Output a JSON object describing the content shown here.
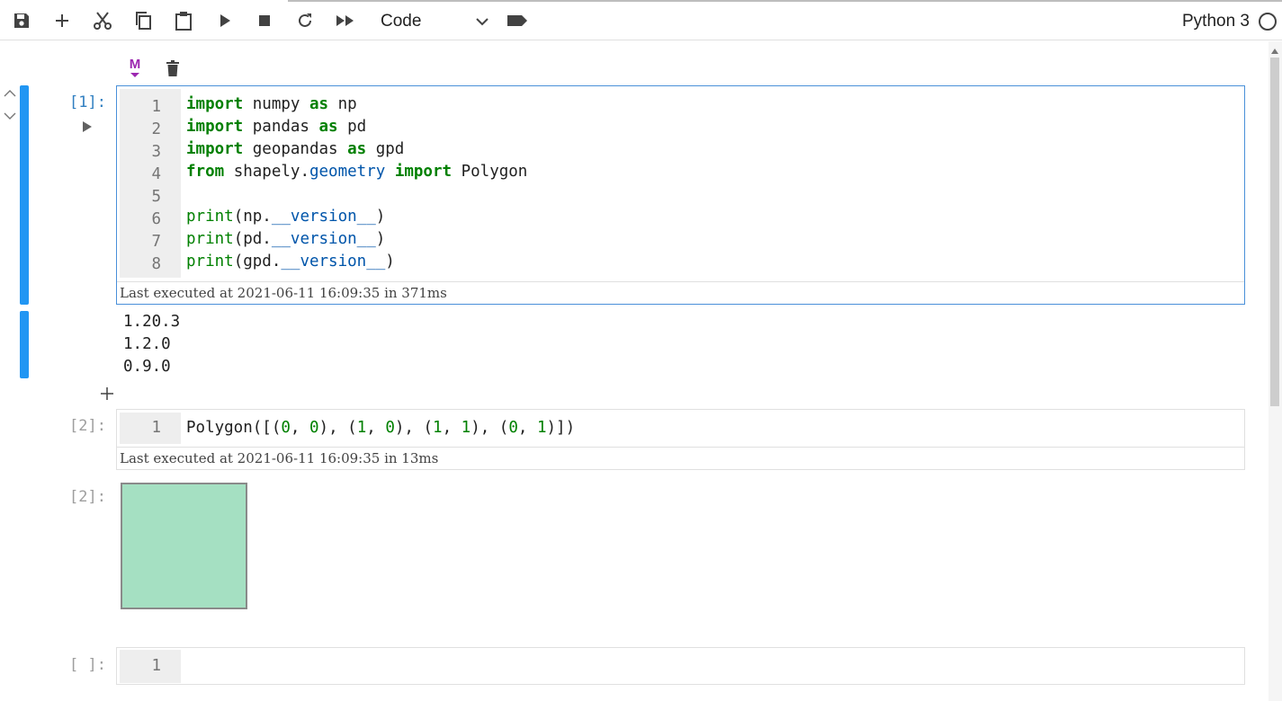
{
  "toolbar": {
    "buttons": [
      {
        "name": "save-icon",
        "label": "save"
      },
      {
        "name": "add-icon",
        "label": "insert cell"
      },
      {
        "name": "cut-icon",
        "label": "cut"
      },
      {
        "name": "copy-icon",
        "label": "copy"
      },
      {
        "name": "paste-icon",
        "label": "paste"
      },
      {
        "name": "run-icon",
        "label": "run"
      },
      {
        "name": "stop-icon",
        "label": "interrupt"
      },
      {
        "name": "restart-icon",
        "label": "restart"
      },
      {
        "name": "fast-forward-icon",
        "label": "restart and run all"
      }
    ],
    "cell_type": "Code",
    "kernel_name": "Python 3"
  },
  "colors": {
    "accent": "#2196f3",
    "keyword": "#008000",
    "attribute": "#0055aa",
    "markdown_icon": "#9c27b0",
    "polygon_fill": "#a5e0c2"
  },
  "cell_toolbar": {
    "markdown_label": "M"
  },
  "cells": [
    {
      "prompt": "[1]:",
      "lines": [
        {
          "n": "1"
        },
        {
          "n": "2"
        },
        {
          "n": "3"
        },
        {
          "n": "4"
        },
        {
          "n": "5"
        },
        {
          "n": "6"
        },
        {
          "n": "7"
        },
        {
          "n": "8"
        }
      ],
      "code": {
        "l1": [
          "import",
          " numpy ",
          "as",
          " np"
        ],
        "l2": [
          "import",
          " pandas ",
          "as",
          " pd"
        ],
        "l3": [
          "import",
          " geopandas ",
          "as",
          " gpd"
        ],
        "l4": [
          "from",
          " shapely.",
          "geometry",
          " ",
          "import",
          " Polygon"
        ],
        "l6": [
          "print",
          "(np.",
          "__version__",
          ")"
        ],
        "l7": [
          "print",
          "(pd.",
          "__version__",
          ")"
        ],
        "l8": [
          "print",
          "(gpd.",
          "__version__",
          ")"
        ]
      },
      "exec_time": "Last executed at 2021-06-11 16:09:35 in 371ms",
      "outputs": [
        "1.20.3",
        "1.2.0",
        "0.9.0"
      ]
    },
    {
      "prompt": "[2]:",
      "lines": [
        {
          "n": "1"
        }
      ],
      "code": {
        "l1": [
          "Polygon([(",
          "0",
          ", ",
          "0",
          "), (",
          "1",
          ", ",
          "0",
          "), (",
          "1",
          ", ",
          "1",
          "), (",
          "0",
          ", ",
          "1",
          ")])"
        ]
      },
      "exec_time": "Last executed at 2021-06-11 16:09:35 in 13ms",
      "output_prompt": "[2]:"
    },
    {
      "prompt": "[ ]:",
      "lines": [
        {
          "n": "1"
        }
      ]
    }
  ]
}
